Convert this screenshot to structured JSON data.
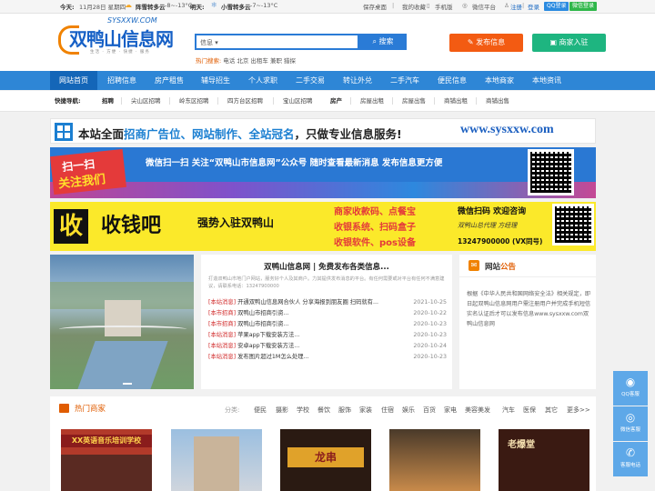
{
  "topbar": {
    "today_label": "今天:",
    "date": "11月28日 星期四",
    "today_weather": "阵雪转多云",
    "today_temp": "-8~-13°C",
    "tomorrow_label": "明天:",
    "tomorrow_weather": "小雪转多云",
    "tomorrow_temp": "-7~-13°C",
    "links": [
      "保存桌面",
      "我的收藏",
      "手机版",
      "微信平台"
    ],
    "register": "注册",
    "login": "登录",
    "qq_login": "QQ登录",
    "wechat_login": "微信登录"
  },
  "logo": {
    "domain": "SYSXXW.COM",
    "name": "双鸭山信息网",
    "slogan": "生活 · 方便 · 快捷 · 服务"
  },
  "search": {
    "category": "信息",
    "button": "搜索",
    "hot_label": "热门搜索:",
    "hot_terms": "电话 北京 出租车 兼职 猎探"
  },
  "header_buttons": {
    "publish": "发布信息",
    "merchant": "商家入驻"
  },
  "nav": [
    "网站首页",
    "招聘信息",
    "房产租售",
    "辅导招生",
    "个人求职",
    "二手交易",
    "转让外兑",
    "二手汽车",
    "便民信息",
    "本地商家",
    "本地资讯"
  ],
  "quick_nav": {
    "label": "快捷导航:",
    "jobs_label": "招聘",
    "jobs": [
      "尖山区招聘",
      "岭东区招聘",
      "四方台区招聘",
      "宝山区招聘"
    ],
    "house_label": "房产",
    "house": [
      "房屋出租",
      "房屋出售",
      "商铺出租",
      "商铺出售"
    ]
  },
  "banner1": {
    "text_a": "本站全面",
    "text_b": "招商广告位、网站制作、全站冠名",
    "text_c": "，只做专业信息服务!",
    "url": "www.sysxxw.com"
  },
  "banner2": {
    "badge_a": "扫一扫",
    "badge_b": "关注我们",
    "text": "微信扫一扫 关注“双鸭山市信息网”公众号 随时查看最新消息 发布信息更方便"
  },
  "banner3": {
    "mark": "收",
    "title": "收钱吧",
    "slogan": "强势入驻双鸭山",
    "l1": "商家收款码、点餐宝",
    "l2": "收银系统、扫码盒子",
    "l3": "收银软件、pos设备",
    "contact": "微信扫码 欢迎咨询",
    "manager": "双鸭山总代理 方经理",
    "phone": "13247900000 (VX同号)"
  },
  "news": {
    "title": "双鸭山信息网 | 免费发布各类信息...",
    "desc": "打造双鸭山市地门户网站，服务好个人及其商户。力其提供发布消息的平台。有任何需要或对平台有任何不满意建议，请联系电话：13247900000",
    "items": [
      {
        "tag": "[本站消息]",
        "text": "开通双鸭山信息网合伙人 分享海报到朋友圈 扫码就有...",
        "date": "2021-10-25"
      },
      {
        "tag": "[本市招商]",
        "text": "双鸭山市招商引资...",
        "date": "2020-10-22"
      },
      {
        "tag": "[本市招商]",
        "text": "双鸭山市招商引资...",
        "date": "2020-10-23"
      },
      {
        "tag": "[本站消息]",
        "text": "苹果app下载安装方法...",
        "date": "2020-10-23"
      },
      {
        "tag": "[本站消息]",
        "text": "安卓app下载安装方法...",
        "date": "2020-10-24"
      },
      {
        "tag": "[本站消息]",
        "text": "发布图片超过1M怎么处理...",
        "date": "2020-10-23"
      }
    ]
  },
  "notice": {
    "title_a": "网站",
    "title_b": "公告",
    "body": "根据《中华人民共和国网络安全法》相关规定，即日起双鸭山信息网用户需注册用户并完成手机短信实名认证后才可以发布信息www.sysxxw.com双鸭山信息网"
  },
  "merchants": {
    "title": "热门商家",
    "cat_label": "分类:",
    "cats": [
      "便民",
      "摄影",
      "学校",
      "餐饮",
      "服饰",
      "家装",
      "住宿",
      "娱乐",
      "百货",
      "家电",
      "美容美发",
      "汽车",
      "医保",
      "其它",
      "更多>>"
    ],
    "img1_text": "XX英语音乐培训学校",
    "img3_text": "龙串",
    "img5_text": "老爆堂"
  },
  "float": [
    "QQ客服",
    "微信客服",
    "客服电话"
  ]
}
